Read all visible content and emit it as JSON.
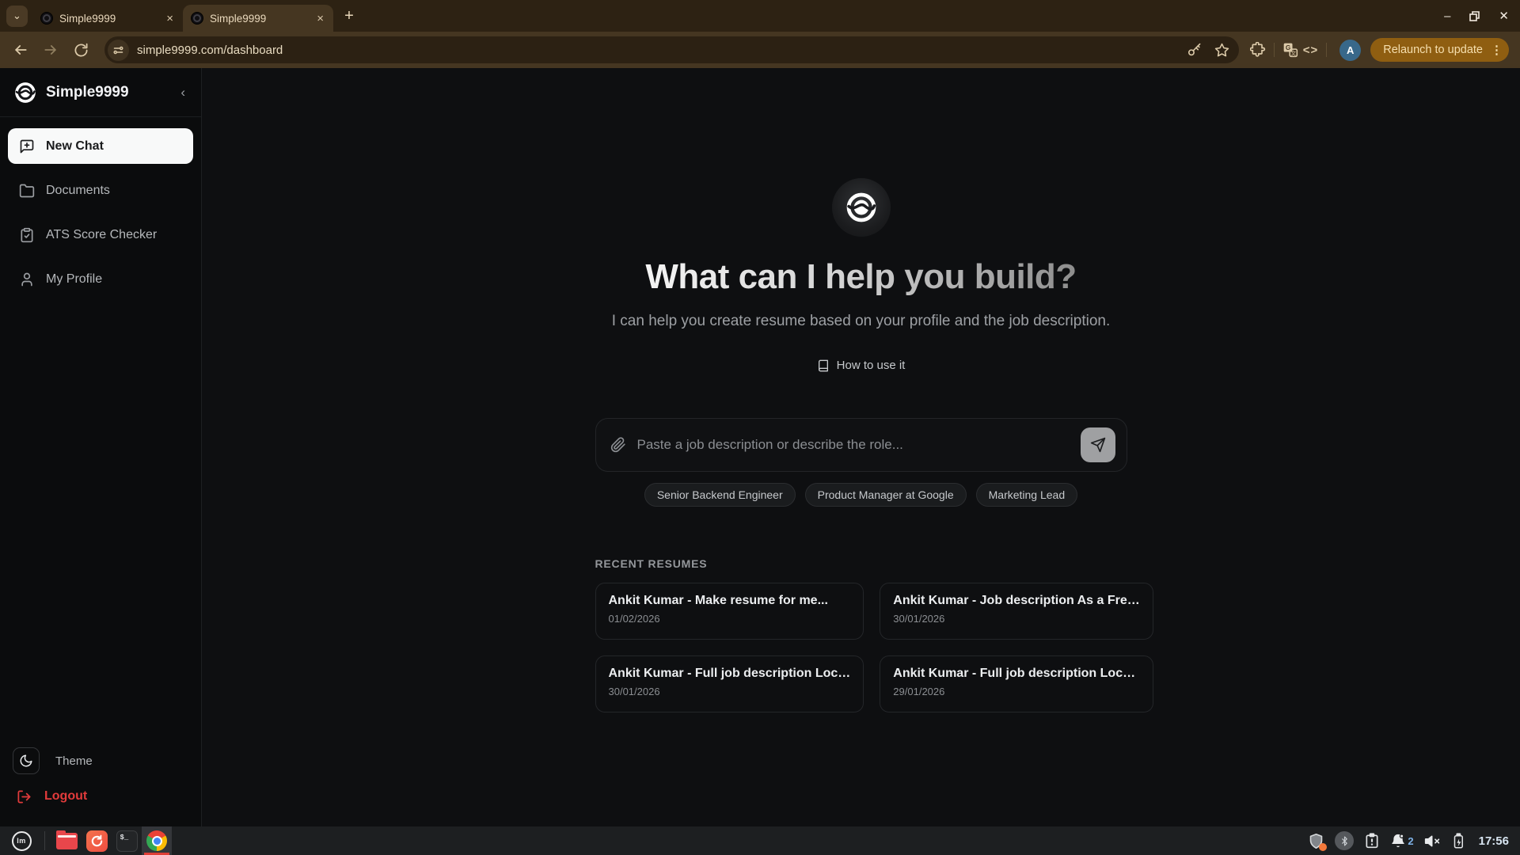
{
  "browser": {
    "tabs": [
      {
        "title": "Simple9999"
      },
      {
        "title": "Simple9999"
      }
    ],
    "url": "simple9999.com/dashboard",
    "relaunch_label": "Relaunch to update",
    "avatar_letter": "A"
  },
  "icons": {
    "tab_search": "⌄",
    "tab_close": "×",
    "new_tab": "+",
    "minimize": "–",
    "window_close": "✕",
    "kebab": "⋮",
    "code": "<>",
    "collapse_chevron": "‹",
    "terminal_glyph": "$_",
    "mint_glyph": "lm"
  },
  "sidebar": {
    "brand": "Simple9999",
    "items": [
      {
        "label": "New Chat"
      },
      {
        "label": "Documents"
      },
      {
        "label": "ATS Score Checker"
      },
      {
        "label": "My Profile"
      }
    ],
    "theme_label": "Theme",
    "logout_label": "Logout"
  },
  "main": {
    "heading": "What can I help you build?",
    "subtitle": "I can help you create resume based on your profile and the job description.",
    "how_to_use": "How to use it",
    "input_placeholder": "Paste a job description or describe the role...",
    "chips": [
      "Senior Backend Engineer",
      "Product Manager at Google",
      "Marketing Lead"
    ],
    "recent_title": "RECENT RESUMES",
    "resumes": [
      {
        "title": "Ankit Kumar - Make resume for me...",
        "date": "01/02/2026"
      },
      {
        "title": "Ankit Kumar - Job description As a Fre…",
        "date": "30/01/2026"
      },
      {
        "title": "Ankit Kumar - Full job description Loc…",
        "date": "30/01/2026"
      },
      {
        "title": "Ankit Kumar - Full job description Loc…",
        "date": "29/01/2026"
      }
    ]
  },
  "taskbar": {
    "notification_count": "2",
    "clock": "17:56"
  },
  "colors": {
    "relaunch_bg": "#8f5e11",
    "logout_red": "#e23b3b",
    "active_nav_bg": "#f8f9f9",
    "chrome_frame": "#2d2213",
    "chrome_toolbar": "#453621",
    "page_bg": "#0e0f11",
    "taskbar_bg": "#1d1f21"
  }
}
